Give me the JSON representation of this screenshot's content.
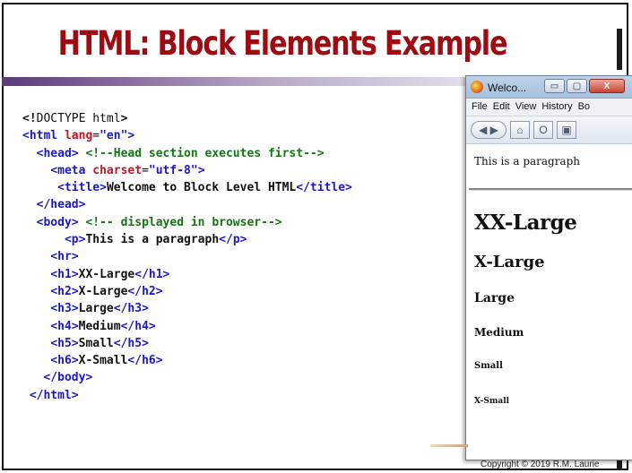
{
  "slide": {
    "title": "HTML: Block Elements Example",
    "copyright": "Copyright © 2019  R.M. Laurie"
  },
  "code": {
    "line1_lt": "<!",
    "line1_doctype": "DOCTYPE html",
    "line1_gt": ">",
    "line2_open": "<html ",
    "line2_attr": "lang",
    "line2_eq": "=",
    "line2_val": "\"en\"",
    "line2_close": ">",
    "line3_tag": "<head>",
    "line3_comment": " <!--Head section executes first-->",
    "line4_open": "<meta ",
    "line4_attr": "charset",
    "line4_eq": "=",
    "line4_val": "\"utf-8\"",
    "line4_close": ">",
    "line5_open": "<title>",
    "line5_text": "Welcome to Block Level HTML",
    "line5_close": "</title>",
    "line6": "</head>",
    "line7_tag": "<body>",
    "line7_comment": " <!-- displayed in browser-->",
    "line8_open": "<p>",
    "line8_text": "This is a paragraph",
    "line8_close": "</p>",
    "line9": "<hr>",
    "line10_open": "<h1>",
    "line10_text": "XX-Large",
    "line10_close": "</h1>",
    "line11_open": "<h2>",
    "line11_text": "X-Large",
    "line11_close": "</h2>",
    "line12_open": "<h3>",
    "line12_text": "Large",
    "line12_close": "</h3>",
    "line13_open": "<h4>",
    "line13_text": "Medium",
    "line13_close": "</h4>",
    "line14_open": "<h5>",
    "line14_text": "Small",
    "line14_close": "</h5>",
    "line15_open": "<h6>",
    "line15_text": "X-Small",
    "line15_close": "</h6>",
    "line16": "</body>",
    "line17": "</html>"
  },
  "browser": {
    "tab_title": "Welco...",
    "minimize": "▭",
    "restore": "▢",
    "close": "X",
    "menu": [
      "File",
      "Edit",
      "View",
      "History",
      "Bo"
    ],
    "nav": {
      "back": "◀ ▶",
      "home": "⌂",
      "reload": "O",
      "bookmark": "▣"
    },
    "content": {
      "p": "This is a paragraph",
      "h1": "XX-Large",
      "h2": "X-Large",
      "h3": "Large",
      "h4": "Medium",
      "h5": "Small",
      "h6": "X-Small"
    }
  },
  "colors": {
    "title": "#9b0d12",
    "tag": "#1a18c9",
    "attr": "#c41425",
    "comment": "#157515"
  }
}
